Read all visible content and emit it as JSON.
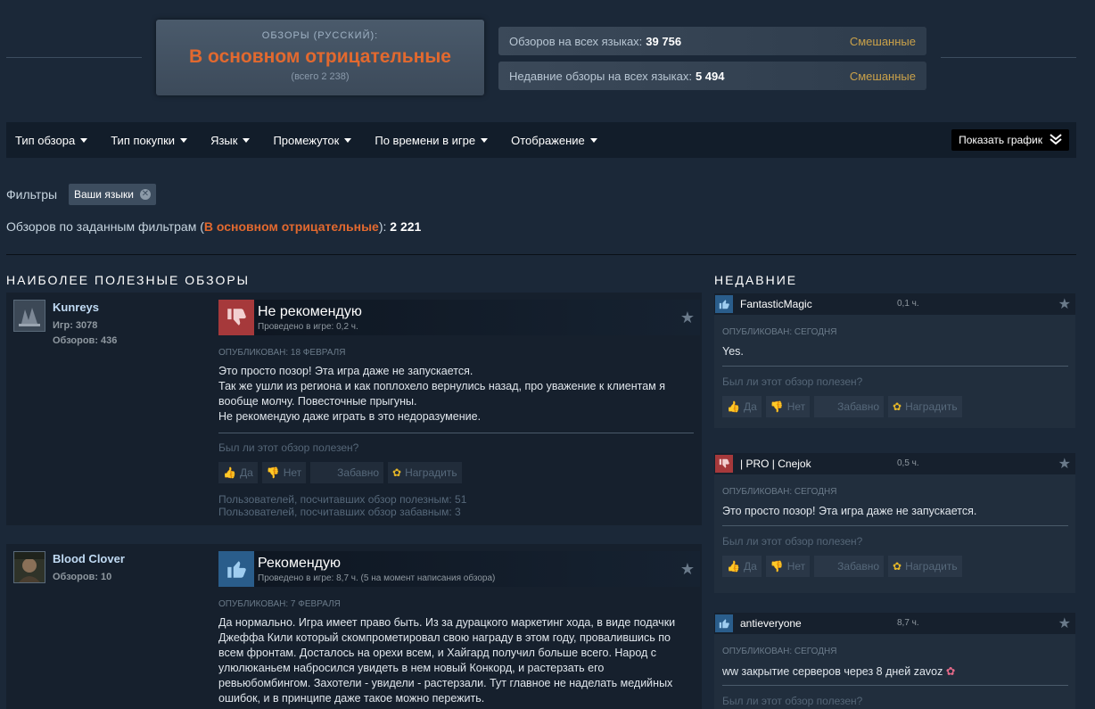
{
  "summary": {
    "label": "ОБЗОРЫ (РУССКИЙ):",
    "verdict": "В основном отрицательные",
    "total": "(всего 2 238)",
    "all_languages": {
      "label": "Обзоров на всех языках:",
      "count": "39 756",
      "rating": "Смешанные"
    },
    "recent_all_languages": {
      "label": "Недавние обзоры на всех языках:",
      "count": "5 494",
      "rating": "Смешанные"
    }
  },
  "filter_bar": {
    "items": [
      "Тип обзора",
      "Тип покупки",
      "Язык",
      "Промежуток",
      "По времени в игре",
      "Отображение"
    ],
    "show_graph": "Показать график"
  },
  "filters": {
    "label": "Фильтры",
    "chip": "Ваши языки"
  },
  "totals": {
    "prefix": "Обзоров по заданным фильтрам (",
    "verdict": "В основном отрицательные",
    "suffix": "):",
    "count": "2 221"
  },
  "sections": {
    "helpful": "НАИБОЛЕЕ ПОЛЕЗНЫЕ ОБЗОРЫ",
    "recent": "НЕДАВНИЕ"
  },
  "vote_labels": {
    "yes": "Да",
    "no": "Нет",
    "funny": "Забавно",
    "award": "Наградить",
    "question": "Был ли этот обзор полезен?"
  },
  "reviews": [
    {
      "author": "Kunreys",
      "games": "Игр: 3078",
      "reviews": "Обзоров: 436",
      "verdict": "Не рекомендую",
      "hours": "Проведено в игре: 0,2 ч.",
      "posted": "ОПУБЛИКОВАН: 18 ФЕВРАЛЯ",
      "lines": [
        "Это просто позор! Эта игра даже не запускается.",
        "Так же ушли из региона и как поплохело вернулись назад, про уважение к клиентам я",
        "вообще молчу. Повесточные прыгуны.",
        "Не рекомендую даже играть в это недоразумение."
      ],
      "helpful_count": "Пользователей, посчитавших обзор полезным: 51",
      "funny_count": "Пользователей, посчитавших обзор забавным: 3"
    },
    {
      "author": "Blood Clover",
      "reviews": "Обзоров: 10",
      "verdict": "Рекомендую",
      "hours": "Проведено в игре: 8,7 ч. (5 на момент написания обзора)",
      "posted": "ОПУБЛИКОВАН: 7 ФЕВРАЛЯ",
      "lines": [
        "Да нормально. Игра имеет право быть. Из за дурацкого маркетинг хода, в виде подачки",
        "Джеффа Кили который скомпрометировал свою награду в этом году, провалившись по",
        "всем фронтам. Досталось на орехи всем, и Хайгард получил больше всего. Народ с",
        "улюлюканьем набросился увидеть в нем новый Конкорд, и растерзать его",
        "ревьюбомбингом. Захотели - увидели - растерзали. Тут главное не наделать медийных",
        "ошибок, и в принципе даже такое можно пережить."
      ]
    }
  ],
  "recent": [
    {
      "name": "FantasticMagic",
      "hours": "0,1 ч.",
      "type": "pos",
      "posted": "ОПУБЛИКОВАН: СЕГОДНЯ",
      "text": "Yes."
    },
    {
      "name": "| PRO | Cnejok",
      "hours": "0,5 ч.",
      "type": "neg",
      "posted": "ОПУБЛИКОВАН: СЕГОДНЯ",
      "text": "Это просто позор! Эта игра даже не запускается."
    },
    {
      "name": "antieveryone",
      "hours": "8,7 ч.",
      "type": "pos",
      "posted": "ОПУБЛИКОВАН: СЕГОДНЯ",
      "text": "ww закрытие серверов через 8 дней zavoz"
    }
  ]
}
